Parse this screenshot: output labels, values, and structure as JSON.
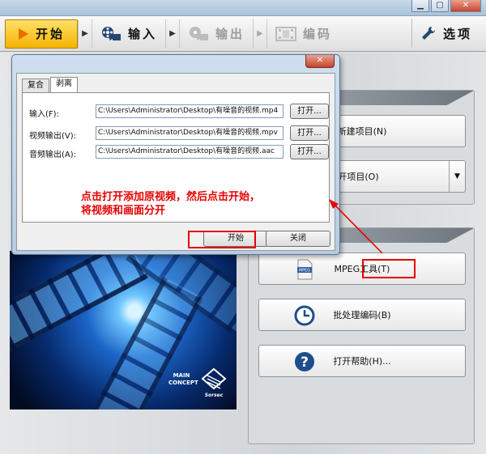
{
  "window": {
    "minimize_glyph": "▁",
    "restore_glyph": "▢",
    "close_glyph": "✕"
  },
  "toolbar": {
    "start_label": "开始",
    "input_label": "输入",
    "output_label": "输出",
    "encode_label": "编码",
    "options_label": "选项",
    "arrow_glyph": "▶"
  },
  "main": {
    "new_project_label": "新建项目(N)",
    "open_project_label": "打开项目(O)",
    "split_arrow_glyph": "▼",
    "mpeg_tools_label": "MPEG工具(T)",
    "mpeg_icon_text": "MPEG",
    "batch_encode_label": "批处理编码(B)",
    "help_label": "打开帮助(H)...",
    "help_icon_text": "?",
    "logo_main_text": "MAIN CONCEPT",
    "logo_sorsec_text": "Sorsec"
  },
  "dialog": {
    "close_glyph": "✕",
    "tabs": [
      {
        "label": "复合",
        "active": false
      },
      {
        "label": "剥离",
        "active": true
      }
    ],
    "rows": [
      {
        "label": "输入(F):",
        "value": "C:\\Users\\Administrator\\Desktop\\有噪音的视频.mp4",
        "button": "打开..."
      },
      {
        "label": "视频输出(V):",
        "value": "C:\\Users\\Administrator\\Desktop\\有噪音的视频.mpv",
        "button": "打开..."
      },
      {
        "label": "音频输出(A):",
        "value": "C:\\Users\\Administrator\\Desktop\\有噪音的视频.aac",
        "button": "打开..."
      }
    ],
    "note_line1": "点击打开添加原视频，然后点击开始，",
    "note_line2": "将视频和画面分开",
    "start_button": "开始",
    "close_button": "关闭"
  },
  "colors": {
    "annotation_red": "#e60000",
    "toolbar_start_yellow": "#f5b300",
    "icon_blue": "#1f4e8c"
  }
}
